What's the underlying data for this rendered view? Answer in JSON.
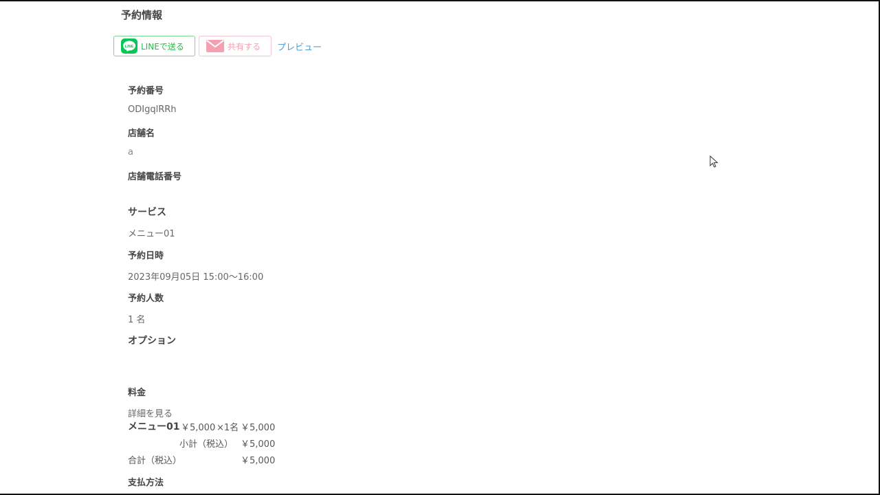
{
  "header": {
    "section_title": "予約情報"
  },
  "toolbar": {
    "line_label": "LINEで送る",
    "line_icon_text": "LINE",
    "share_label": "共有する",
    "preview_label": "プレビュー"
  },
  "fields": {
    "reservation_number_label": "予約番号",
    "reservation_number_value": "ODIgqlRRh",
    "store_name_label": "店舗名",
    "store_name_value": "a",
    "store_phone_label": "店舗電話番号",
    "store_phone_value": "",
    "service_label": "サービス",
    "service_value": "メニュー01",
    "datetime_label": "予約日時",
    "datetime_value": "2023年09月05日 15:00～16:00",
    "people_label": "予約人数",
    "people_value": "1 名",
    "option_label": "オプション",
    "option_value": "",
    "price_label": "料金",
    "payment_label": "支払方法"
  },
  "price_detail": {
    "details_link": "詳細を見る",
    "item_name": "メニュー01",
    "item_unit_price": "￥5,000",
    "item_quantity": "×1名",
    "item_total": "￥5,000",
    "subtotal_label": "小計（税込）",
    "subtotal_value": "￥5,000",
    "total_label": "合計（税込）",
    "total_value": "￥5,000"
  },
  "colors": {
    "line_green": "#06c755",
    "share_pink": "#f1a3b4",
    "preview_blue": "#4b9fd6"
  }
}
